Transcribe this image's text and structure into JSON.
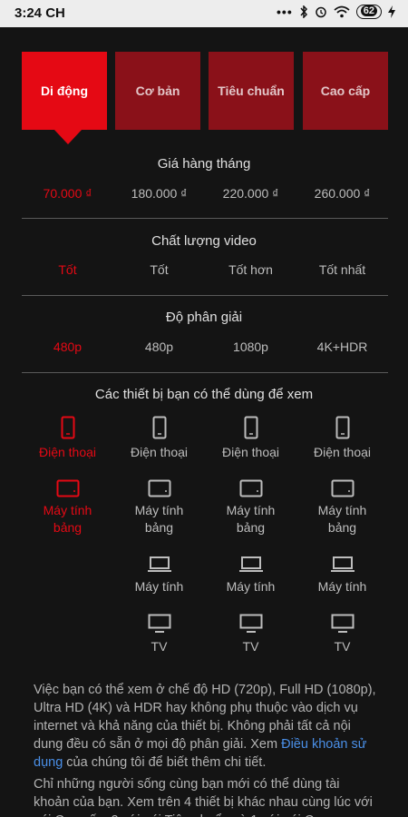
{
  "status_bar": {
    "time": "3:24 CH",
    "battery": "62"
  },
  "plans": [
    {
      "label": "Di động",
      "active": true
    },
    {
      "label": "Cơ bản",
      "active": false
    },
    {
      "label": "Tiêu chuẩn",
      "active": false
    },
    {
      "label": "Cao cấp",
      "active": false
    }
  ],
  "price": {
    "title": "Giá hàng tháng",
    "values": [
      "70.000 ₫",
      "180.000 ₫",
      "220.000 ₫",
      "260.000 ₫"
    ]
  },
  "quality": {
    "title": "Chất lượng video",
    "values": [
      "Tốt",
      "Tốt",
      "Tốt hơn",
      "Tốt nhất"
    ]
  },
  "resolution": {
    "title": "Độ phân giải",
    "values": [
      "480p",
      "480p",
      "1080p",
      "4K+HDR"
    ]
  },
  "devices": {
    "title": "Các thiết bị bạn có thể dùng để xem",
    "labels": {
      "phone": "Điện thoại",
      "tablet_line1": "Máy tính",
      "tablet_line2": "bảng",
      "computer": "Máy tính",
      "tv": "TV"
    }
  },
  "disclaimer": {
    "p1_text": "Việc bạn có thể xem ở chế độ HD (720p), Full HD (1080p), Ultra HD (4K) và HDR hay không phụ thuộc vào dịch vụ internet và khả năng của thiết bị. Không phải tất cả nội dung đều có sẵn ở mọi độ phân giải. Xem ",
    "p1_link": "Điều khoản sử dụng",
    "p1_after": " của chúng tôi để biết thêm chi tiết.",
    "p2_text": "Chỉ những người sống cùng bạn mới có thể dùng tài khoản của bạn. Xem trên 4 thiết bị khác nhau cùng lúc với gói Cao cấp, 2 với gói Tiêu chuẩn và 1 với gói Cơ"
  },
  "colors": {
    "accent": "#e50914",
    "plan_inactive": "#8a1119",
    "link": "#4a8fe7",
    "background": "#141414"
  }
}
